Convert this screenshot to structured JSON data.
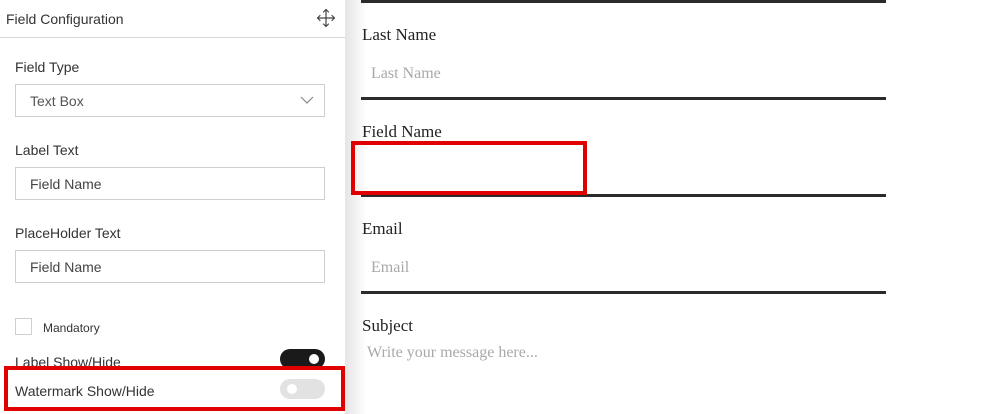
{
  "panel": {
    "title": "Field Configuration",
    "move_icon": "move-arrows-icon",
    "field_type": {
      "label": "Field Type",
      "value": "Text Box",
      "icon": "chevron-down-icon"
    },
    "label_text": {
      "label": "Label Text",
      "value": "Field Name"
    },
    "placeholder_text": {
      "label": "PlaceHolder Text",
      "value": "Field Name"
    },
    "mandatory": {
      "label": "Mandatory",
      "checked": false
    },
    "label_toggle": {
      "label": "Label Show/Hide",
      "on": true
    },
    "watermark_toggle": {
      "label": "Watermark Show/Hide",
      "on": false
    }
  },
  "form": {
    "last_name": {
      "label": "Last Name",
      "placeholder": "Last Name"
    },
    "field_name": {
      "label": "Field Name",
      "placeholder": ""
    },
    "email": {
      "label": "Email",
      "placeholder": "Email"
    },
    "subject": {
      "label": "Subject",
      "placeholder": "Write your message here..."
    }
  },
  "colors": {
    "highlight": "#e00000",
    "divider": "#2b2b2b",
    "toggle_on": "#1a1a1a",
    "toggle_off": "#e2e2e2",
    "placeholder": "#a9a9a9"
  }
}
